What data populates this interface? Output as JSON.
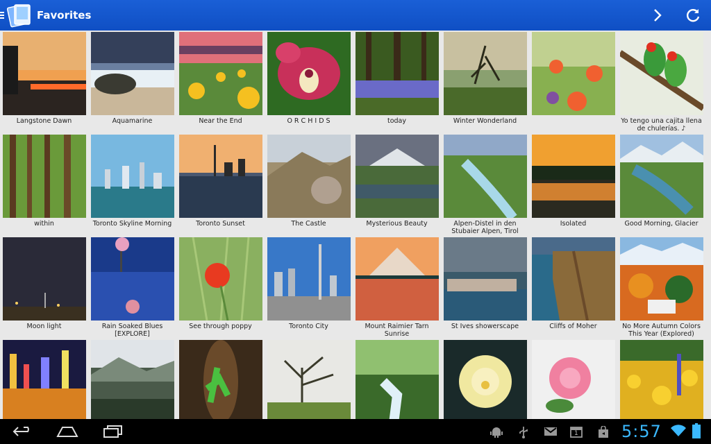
{
  "app": {
    "title": "Favorites"
  },
  "action_bar": {
    "next_icon": "chevron-right-icon",
    "refresh_icon": "refresh-icon"
  },
  "photos": [
    {
      "caption": "Langstone Dawn"
    },
    {
      "caption": "Aquamarine"
    },
    {
      "caption": "Near the End"
    },
    {
      "caption": "O R C H I D S"
    },
    {
      "caption": "today"
    },
    {
      "caption": "Winter Wonderland"
    },
    {
      "caption": ""
    },
    {
      "caption": "Yo tengo una cajita llena de chulerías. ♪"
    },
    {
      "caption": "within"
    },
    {
      "caption": "Toronto Skyline Morning"
    },
    {
      "caption": "Toronto Sunset"
    },
    {
      "caption": "The Castle"
    },
    {
      "caption": "Mysterious Beauty"
    },
    {
      "caption": "Alpen-Distel in den Stubaier Alpen, Tirol"
    },
    {
      "caption": "Isolated"
    },
    {
      "caption": "Good Morning, Glacier"
    },
    {
      "caption": "Moon light"
    },
    {
      "caption": "Rain Soaked Blues [EXPLORE]"
    },
    {
      "caption": "See through poppy"
    },
    {
      "caption": "Toronto City"
    },
    {
      "caption": "Mount Raimier Tarn Sunrise"
    },
    {
      "caption": "St Ives showerscape"
    },
    {
      "caption": "Cliffs of Moher"
    },
    {
      "caption": "No More Autumn Colors This Year (Explored)"
    },
    {
      "caption": ""
    },
    {
      "caption": ""
    },
    {
      "caption": ""
    },
    {
      "caption": ""
    },
    {
      "caption": ""
    },
    {
      "caption": ""
    },
    {
      "caption": ""
    },
    {
      "caption": ""
    }
  ],
  "navbar": {
    "back_icon": "back-icon",
    "home_icon": "home-icon",
    "recents_icon": "recent-apps-icon"
  },
  "status": {
    "time": "5:57",
    "notification_count": "1",
    "icons": [
      "android-debug-icon",
      "usb-icon",
      "gmail-icon",
      "calendar-icon",
      "shopping-bag-icon",
      "wifi-icon",
      "battery-icon"
    ]
  },
  "colors": {
    "accent": "#1a5fd6",
    "clock": "#3bb9ff"
  }
}
